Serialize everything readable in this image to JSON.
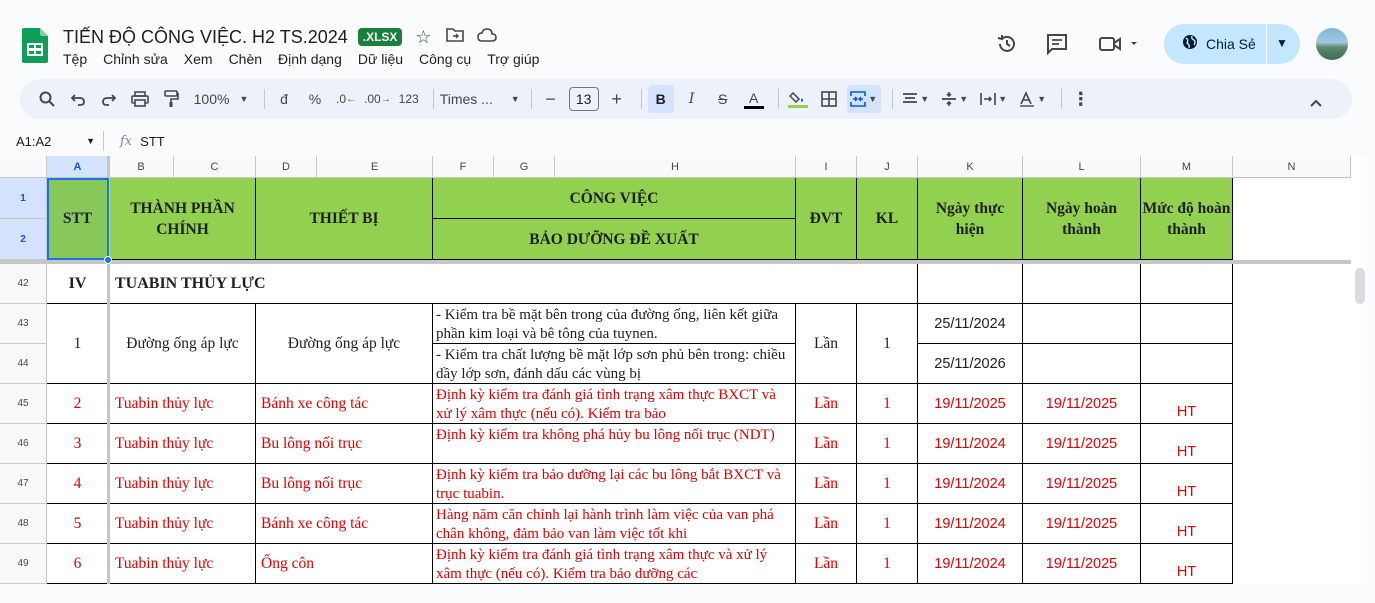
{
  "app": {
    "title": "TIẾN ĐỘ CÔNG VIỆC. H2 TS.2024",
    "badge": ".XLSX",
    "menu": [
      "Tệp",
      "Chỉnh sửa",
      "Xem",
      "Chèn",
      "Định dạng",
      "Dữ liệu",
      "Công cụ",
      "Trợ giúp"
    ],
    "share_label": "Chia Sẻ",
    "accent": "#c2e7ff",
    "brand_green": "#188038"
  },
  "toolbar": {
    "zoom": "100%",
    "currency": "đ",
    "percent": "%",
    "dec_decrease": ".0",
    "dec_increase": ".00",
    "number_format": "123",
    "font": "Times ...",
    "font_size": "13",
    "bold": "B",
    "italic": "I",
    "text_color": "A"
  },
  "formula": {
    "namebox": "A1:A2",
    "fx": "fx",
    "content": "STT"
  },
  "columns": [
    "A",
    "B",
    "C",
    "D",
    "E",
    "F",
    "G",
    "H",
    "I",
    "J",
    "K",
    "L",
    "M",
    "N"
  ],
  "rows": [
    "1",
    "2",
    "42",
    "43",
    "44",
    "45",
    "46",
    "47",
    "48",
    "49"
  ],
  "header": {
    "stt": "STT",
    "thanh_phan": "THÀNH PHẦN CHÍNH",
    "thiet_bi": "THIẾT BỊ",
    "cong_viec": "CÔNG VIỆC",
    "bao_duong": "BẢO DƯỠNG ĐỀ XUẤT",
    "dvt": "ĐVT",
    "kl": "KL",
    "ngay_thuc_hien": "Ngày thực hiện",
    "ngay_hoan_thanh": "Ngày hoàn thành",
    "muc_do": "Mức độ hoàn thành"
  },
  "section": {
    "stt": "IV",
    "name": "TUABIN THỦY LỰC"
  },
  "data_rows": [
    {
      "stt": "1",
      "thanh_phan": "Đường ống áp lực",
      "thiet_bi": "Đường ống áp lực",
      "cong_viec_a": "- Kiểm tra bề mặt bên trong của đường ống, liên kết giữa phần kim loại và bê tông của tuynen.",
      "cong_viec_b": "- Kiểm tra chất lượng bề mặt lớp sơn phủ bên trong: chiều dầy lớp sơn, đánh dấu các vùng bị",
      "dvt": "Lần",
      "kl": "1",
      "ngay_a": "25/11/2024",
      "ngay_b": "25/11/2026"
    },
    {
      "stt": "2",
      "thanh_phan": "Tuabin thủy lực",
      "thiet_bi": "Bánh xe công tác",
      "cong_viec": "Định kỳ kiểm tra đánh giá tình trạng xâm thực BXCT và xử lý xâm thực (nếu có). Kiểm tra bảo",
      "dvt": "Lần",
      "kl": "1",
      "ngay_thuc_hien": "19/11/2025",
      "ngay_hoan_thanh": "19/11/2025",
      "muc_do": "HT"
    },
    {
      "stt": "3",
      "thanh_phan": "Tuabin thủy lực",
      "thiet_bi": "Bu lông nối trục",
      "cong_viec": "Định kỳ kiểm tra không phá hủy bu lông nối trục (NDT)",
      "dvt": "Lần",
      "kl": "1",
      "ngay_thuc_hien": "19/11/2024",
      "ngay_hoan_thanh": "19/11/2025",
      "muc_do": "HT"
    },
    {
      "stt": "4",
      "thanh_phan": "Tuabin thủy lực",
      "thiet_bi": "Bu lông nối trục",
      "cong_viec": "Định kỳ kiểm tra bảo dưỡng lại các bu lông bắt BXCT và trục tuabin.",
      "dvt": "Lần",
      "kl": "1",
      "ngay_thuc_hien": "19/11/2024",
      "ngay_hoan_thanh": "19/11/2025",
      "muc_do": "HT"
    },
    {
      "stt": "5",
      "thanh_phan": "Tuabin thủy lực",
      "thiet_bi": "Bánh xe công tác",
      "cong_viec": "Hàng năm căn chỉnh lại hành trình làm việc của van phá chân không, đảm bảo van làm việc tốt khi",
      "dvt": "Lần",
      "kl": "1",
      "ngay_thuc_hien": "19/11/2024",
      "ngay_hoan_thanh": "19/11/2025",
      "muc_do": "HT"
    },
    {
      "stt": "6",
      "thanh_phan": "Tuabin thủy lực",
      "thiet_bi": "Ống côn",
      "cong_viec": "Định kỳ kiểm tra đánh giá tình trạng xâm thực và xử lý xâm thực (nếu có). Kiểm tra bảo dưỡng các",
      "dvt": "Lần",
      "kl": "1",
      "ngay_thuc_hien": "19/11/2024",
      "ngay_hoan_thanh": "19/11/2025",
      "muc_do": "HT"
    }
  ]
}
